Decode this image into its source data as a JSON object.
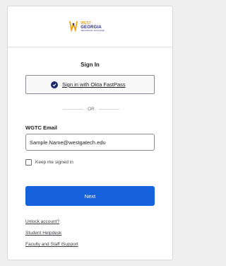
{
  "logo": {
    "west": "WEST",
    "georgia": "GEORGIA",
    "subtitle": "TECHNICAL COLLEGE"
  },
  "title": "Sign In",
  "okta_button": {
    "label": "Sign in with Okta FastPass"
  },
  "divider": {
    "label": "OR"
  },
  "email": {
    "label": "WGTC Email",
    "value": "Sample.Name@westgatech.edu"
  },
  "keep_signed_in": {
    "label": "Keep me signed in",
    "checked": false
  },
  "next_button": {
    "label": "Next"
  },
  "links": {
    "unlock": "Unlock account?",
    "helpdesk": "Student Helpdesk",
    "staff": "Faculty and Staff iSupport"
  },
  "colors": {
    "primary_button": "#1662dd",
    "brand_gold": "#e8a317",
    "brand_navy": "#2a2a86",
    "okta_icon": "#1a2b6b"
  }
}
